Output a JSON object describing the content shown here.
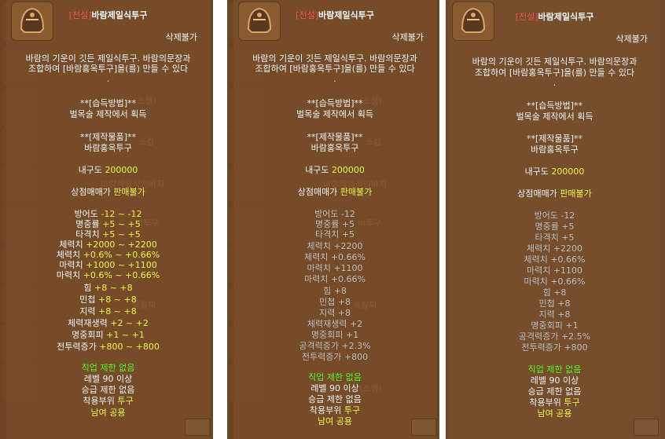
{
  "tooltips": [
    {
      "title_tag": "[전설]",
      "title_name": "바람제일식투구",
      "trade": "삭제불가",
      "desc1": "바람의 기운이 깃든 제일식투구. 바람의문장과",
      "desc2": "조합하여 [바람홍옥투구]을(를) 만들 수 있다",
      "desc3": ".",
      "method_head": "**[습득방법]**",
      "method_val": "벌목술 제작에서 획득",
      "craft_head": "**[제작물품]**",
      "craft_val": "바람홍옥투구",
      "durability_label": "내구도",
      "durability_val": "200000",
      "shop_label": "상점매매가",
      "shop_val": "판매불가",
      "stats": [
        {
          "label": "방어도",
          "val": "-12 ~ -12"
        },
        {
          "label": "명중률",
          "val": "+5 ~ +5"
        },
        {
          "label": "타격치",
          "val": "+5 ~ +5"
        },
        {
          "label": "체력치",
          "val": "+2000 ~ +2200"
        },
        {
          "label": "체력치",
          "val": "+0.6% ~ +0.66%"
        },
        {
          "label": "마력치",
          "val": "+1000 ~ +1100"
        },
        {
          "label": "마력치",
          "val": "+0.6% ~ +0.66%"
        },
        {
          "label": "힘",
          "val": "+8 ~ +8"
        },
        {
          "label": "민첩",
          "val": "+8 ~ +8"
        },
        {
          "label": "지력",
          "val": "+8 ~ +8"
        },
        {
          "label": "체력재생력",
          "val": "+2 ~ +2"
        },
        {
          "label": "명중회피",
          "val": "+1 ~ +1"
        },
        {
          "label": "전투력증가",
          "val": "+800 ~ +800"
        }
      ],
      "job": "직업 제한 없음",
      "level": "레벨 90 이상",
      "promo": "승급 제한 없음",
      "wear_label": "착용부위",
      "wear_val": "투구",
      "gender": "남여 공용",
      "bg": [
        "(소생)",
        "소갑",
        "바람제일식인바지",
        "비투구",
        "속팔찌"
      ]
    },
    {
      "title_tag": "[전설]",
      "title_name": "바람제일식투구",
      "trade": "삭제불가",
      "desc1": "바람의 기운이 깃든 제일식투구. 바람의문장과",
      "desc2": "조합하여 [바람홍옥투구]을(를) 만들 수 있다",
      "desc3": ".",
      "method_head": "**[습득방법]**",
      "method_val": "벌목술 제작에서 획득",
      "craft_head": "**[제작물품]**",
      "craft_val": "바람홍옥투구",
      "durability_label": "내구도",
      "durability_val": "200000",
      "shop_label": "상점매매가",
      "shop_val": "판매불가",
      "stats": [
        {
          "label": "방어도",
          "val": "-12"
        },
        {
          "label": "명중률",
          "val": "+5"
        },
        {
          "label": "타격치",
          "val": "+5"
        },
        {
          "label": "체력치",
          "val": "+2200"
        },
        {
          "label": "체력치",
          "val": "+0.66%"
        },
        {
          "label": "마력치",
          "val": "+1100"
        },
        {
          "label": "마력치",
          "val": "+0.66%"
        },
        {
          "label": "힘",
          "val": "+8"
        },
        {
          "label": "민첩",
          "val": "+8"
        },
        {
          "label": "지력",
          "val": "+8"
        },
        {
          "label": "체력재생력",
          "val": "+2"
        },
        {
          "label": "명중회피",
          "val": "+1"
        },
        {
          "label": "공격력증가",
          "val": "+2.3%"
        },
        {
          "label": "전투력증가",
          "val": "+800"
        }
      ],
      "job": "직업 제한 없음",
      "level": "레벨 90 이상",
      "promo": "승급 제한 없음",
      "wear_label": "착용부위",
      "wear_val": "투구",
      "gender": "남여 공용",
      "bg": [
        "(소생)",
        "소갑",
        "바람제일식인바지",
        "비투구",
        "속팔찌",
        "(소생)"
      ]
    },
    {
      "title_tag": "[전설]",
      "title_name": "바람제일식투구",
      "trade": "삭제불가",
      "desc1": "바람의 기운이 깃든 제일식투구. 바람의문장과",
      "desc2": "조합하여 [바람홍옥투구]을(를) 만들 수 있다",
      "desc3": ".",
      "method_head": "**[습득방법]**",
      "method_val": "벌목술 제작에서 획득",
      "craft_head": "**[제작물품]**",
      "craft_val": "바람홍옥투구",
      "durability_label": "내구도",
      "durability_val": "200000",
      "shop_label": "상점매매가",
      "shop_val": "판매불가",
      "stats": [
        {
          "label": "방어도",
          "val": "-12"
        },
        {
          "label": "명중률",
          "val": "+5"
        },
        {
          "label": "타격치",
          "val": "+5"
        },
        {
          "label": "체력치",
          "val": "+2200"
        },
        {
          "label": "체력치",
          "val": "+0.66%"
        },
        {
          "label": "마력치",
          "val": "+1100"
        },
        {
          "label": "마력치",
          "val": "+0.66%"
        },
        {
          "label": "힘",
          "val": "+8"
        },
        {
          "label": "민첩",
          "val": "+8"
        },
        {
          "label": "지력",
          "val": "+8"
        },
        {
          "label": "명중회피",
          "val": "+1"
        },
        {
          "label": "공격력증가",
          "val": "+2.5%"
        },
        {
          "label": "전투력증가",
          "val": "+800"
        }
      ],
      "job": "직업 제한 없음",
      "level": "레벨 90 이상",
      "promo": "승급 제한 없음",
      "wear_label": "착용부위",
      "wear_val": "투구",
      "gender": "남여 공용",
      "bg": []
    }
  ]
}
